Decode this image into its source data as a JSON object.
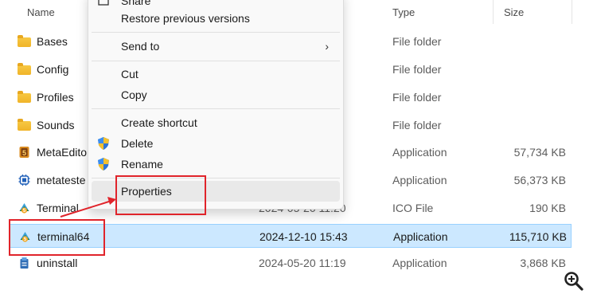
{
  "headers": {
    "name": "Name",
    "type": "Type",
    "size": "Size"
  },
  "files": [
    {
      "name": "Bases",
      "date": "",
      "type": "File folder",
      "size": "",
      "icon": "folder-icon"
    },
    {
      "name": "Config",
      "date": "",
      "type": "File folder",
      "size": "",
      "icon": "folder-icon"
    },
    {
      "name": "Profiles",
      "date": "",
      "type": "File folder",
      "size": "",
      "icon": "folder-icon"
    },
    {
      "name": "Sounds",
      "date": "",
      "type": "File folder",
      "size": "",
      "icon": "folder-icon"
    },
    {
      "name": "MetaEdito",
      "date": "",
      "type": "Application",
      "size": "57,734 KB",
      "icon": "metaeditor-icon"
    },
    {
      "name": "metateste",
      "date": "",
      "type": "Application",
      "size": "56,373 KB",
      "icon": "metatester-icon"
    },
    {
      "name": "Terminal",
      "date": "2024-05-20 11:20",
      "type": "ICO File",
      "size": "190 KB",
      "icon": "terminal-icon"
    },
    {
      "name": "terminal64",
      "date": "2024-12-10 15:43",
      "type": "Application",
      "size": "115,710 KB",
      "icon": "terminal-icon"
    },
    {
      "name": "uninstall",
      "date": "2024-05-20 11:19",
      "type": "Application",
      "size": "3,868 KB",
      "icon": "uninstall-icon"
    }
  ],
  "context_menu": {
    "share": "Share",
    "restore": "Restore previous versions",
    "send_to": "Send to",
    "cut": "Cut",
    "copy": "Copy",
    "create_shortcut": "Create shortcut",
    "delete": "Delete",
    "rename": "Rename",
    "properties": "Properties"
  },
  "colors": {
    "selection": "#cce8ff",
    "annotation": "#e0242b",
    "folder": "#f0b429"
  }
}
